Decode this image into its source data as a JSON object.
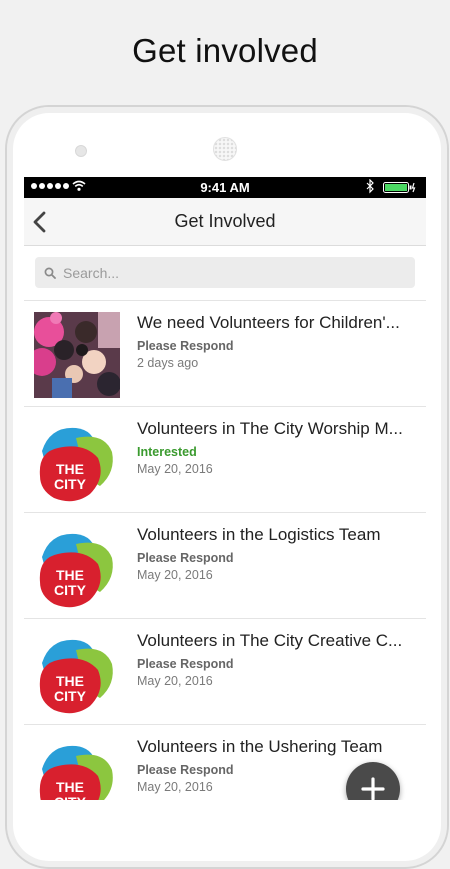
{
  "headline": "Get involved",
  "status_bar": {
    "time": "9:41 AM"
  },
  "navbar": {
    "title": "Get Involved"
  },
  "search": {
    "placeholder": "Search..."
  },
  "items": [
    {
      "title": "We need Volunteers for Children'...",
      "status": "Please Respond",
      "date": "2 days ago",
      "thumbnail": "photo"
    },
    {
      "title": "Volunteers in The City Worship M...",
      "status": "Interested",
      "date": "May 20, 2016",
      "thumbnail": "the-city-logo"
    },
    {
      "title": "Volunteers in the Logistics Team",
      "status": "Please Respond",
      "date": "May 20, 2016",
      "thumbnail": "the-city-logo"
    },
    {
      "title": "Volunteers in The City Creative C...",
      "status": "Please Respond",
      "date": "May 20, 2016",
      "thumbnail": "the-city-logo"
    },
    {
      "title": "Volunteers in the Ushering Team",
      "status": "Please Respond",
      "date": "May 20, 2016",
      "thumbnail": "the-city-logo"
    }
  ],
  "logo": {
    "line1": "THE",
    "line2": "CITY"
  },
  "colors": {
    "interested": "#3a9a2e",
    "logo_red": "#d8202e",
    "logo_blue": "#2a9fd8",
    "logo_green": "#8cc63f",
    "fab": "#4a4a4a"
  },
  "icons": {
    "back": "chevron-left-icon",
    "search": "search-icon",
    "fab": "plus-icon"
  }
}
